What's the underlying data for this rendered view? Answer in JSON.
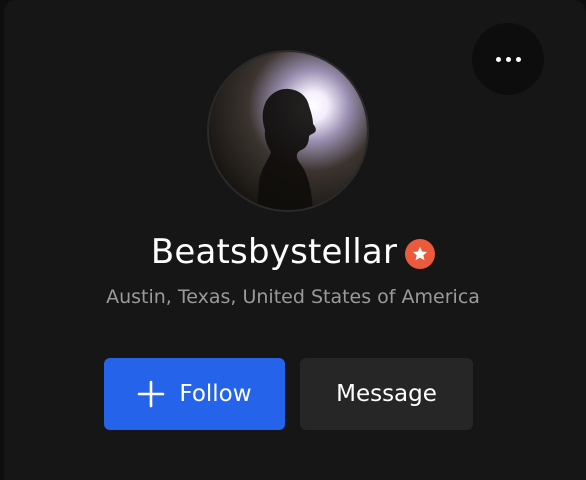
{
  "profile": {
    "name": "Beatsbystellar",
    "location": "Austin, Texas, United States of America",
    "avatar_icon": "silhouette-avatar",
    "badge_icon": "star-badge-icon"
  },
  "actions": {
    "more_icon": "more-horizontal-icon",
    "follow_label": "Follow",
    "follow_icon": "plus-icon",
    "message_label": "Message"
  },
  "colors": {
    "background": "#161616",
    "follow": "#2563eb",
    "message": "#262626",
    "badge": "#ec5a3e",
    "location_text": "#9a9a9a"
  }
}
